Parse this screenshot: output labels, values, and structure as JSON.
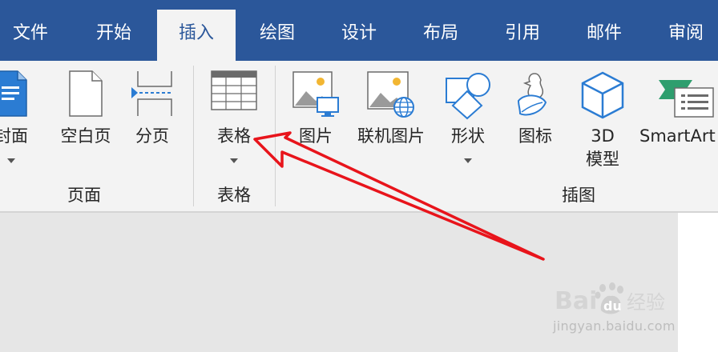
{
  "tabs": [
    {
      "label": "文件",
      "active": false
    },
    {
      "label": "开始",
      "active": false
    },
    {
      "label": "插入",
      "active": true
    },
    {
      "label": "绘图",
      "active": false
    },
    {
      "label": "设计",
      "active": false
    },
    {
      "label": "布局",
      "active": false
    },
    {
      "label": "引用",
      "active": false
    },
    {
      "label": "邮件",
      "active": false
    },
    {
      "label": "审阅",
      "active": false
    }
  ],
  "ribbon": {
    "groups": {
      "pages": {
        "label": "页面",
        "buttons": {
          "cover": {
            "label": "封面",
            "icon": "cover-page-icon"
          },
          "blank": {
            "label": "空白页",
            "icon": "blank-page-icon"
          },
          "break": {
            "label": "分页",
            "icon": "page-break-icon"
          }
        }
      },
      "tables": {
        "label": "表格",
        "buttons": {
          "table": {
            "label": "表格",
            "icon": "table-icon"
          }
        }
      },
      "illustrations": {
        "label": "插图",
        "buttons": {
          "picture": {
            "label": "图片",
            "icon": "picture-icon"
          },
          "online_picture": {
            "label": "联机图片",
            "icon": "online-picture-icon"
          },
          "shapes": {
            "label": "形状",
            "icon": "shapes-icon"
          },
          "icons": {
            "label": "图标",
            "icon": "icons-icon"
          },
          "model3d": {
            "label": "3D\n模型",
            "line1": "3D",
            "line2": "模型",
            "icon": "3d-model-icon"
          },
          "smartart": {
            "label": "SmartArt",
            "icon": "smartart-icon"
          }
        }
      }
    }
  },
  "annotation": {
    "color": "#e8141b"
  },
  "watermark": {
    "brand": "Baidu经验",
    "brand_prefix": "Bai",
    "brand_mid": "du",
    "brand_suffix": "经验",
    "site": "jingyan.baidu.com"
  },
  "colors": {
    "accent": "#2b579a",
    "ribbon": "#f3f3f3",
    "canvas": "#e6e6e6",
    "icon_blue": "#2b7cd3"
  }
}
